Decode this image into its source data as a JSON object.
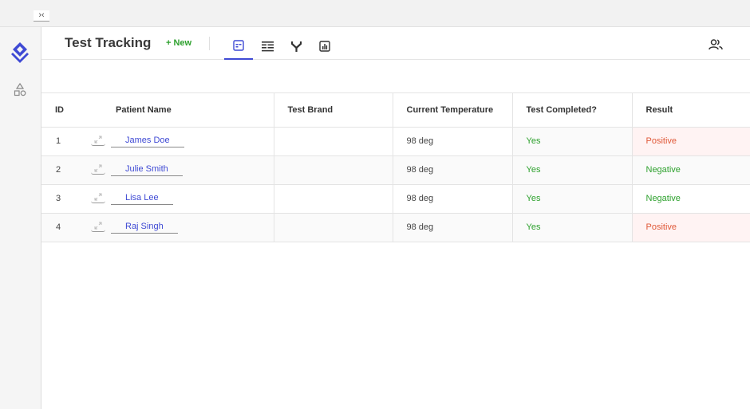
{
  "app": {
    "title": "Test Tracking",
    "new_label": "+ New",
    "collapse_label": "›‹",
    "accent": "#3f4ad4"
  },
  "views": [
    {
      "name": "grid-view",
      "icon": "grid-view-icon",
      "active": true
    },
    {
      "name": "form-view",
      "icon": "form-view-icon",
      "active": false
    },
    {
      "name": "flow-view",
      "icon": "branch-icon",
      "active": false
    },
    {
      "name": "chart-view",
      "icon": "bar-chart-icon",
      "active": false
    }
  ],
  "table": {
    "headers": [
      "ID",
      "",
      "Patient Name",
      "Test Brand",
      "Current Temperature",
      "Test Completed?",
      "Result"
    ],
    "rows": [
      {
        "id": "1",
        "name": "James Doe",
        "brand": "",
        "temp": "98 deg",
        "completed": "Yes",
        "result": "Positive"
      },
      {
        "id": "2",
        "name": "Julie Smith",
        "brand": "",
        "temp": "98 deg",
        "completed": "Yes",
        "result": "Negative"
      },
      {
        "id": "3",
        "name": "Lisa Lee",
        "brand": "",
        "temp": "98 deg",
        "completed": "Yes",
        "result": "Negative"
      },
      {
        "id": "4",
        "name": "Raj Singh",
        "brand": "",
        "temp": "98 deg",
        "completed": "Yes",
        "result": "Positive"
      }
    ]
  },
  "colors": {
    "positive": "#e05a3a",
    "negative": "#2ea12e",
    "yes": "#2ea12e"
  }
}
